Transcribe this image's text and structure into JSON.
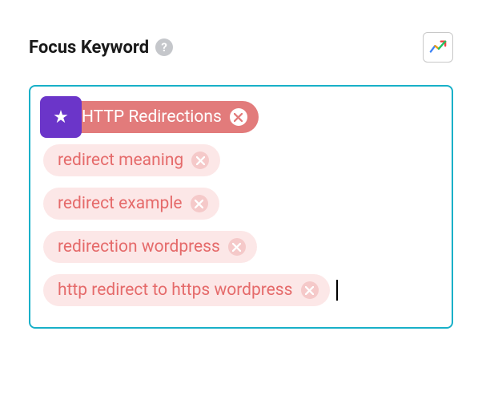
{
  "header": {
    "title": "Focus Keyword",
    "help_symbol": "?"
  },
  "keywords": {
    "primary": {
      "label": "HTTP Redirections",
      "starred": true
    },
    "secondary": [
      {
        "label": "redirect meaning"
      },
      {
        "label": "redirect example"
      },
      {
        "label": "redirection wordpress"
      },
      {
        "label": "http redirect to https wordpress"
      }
    ]
  }
}
